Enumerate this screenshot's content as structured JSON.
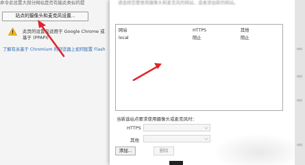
{
  "background_page": {
    "top_text": "命令此设置大部分网站是否有能此类似的提",
    "site_button_label": "站点的摄像头和麦克风设置...",
    "warning_text": "此页的设置仅适用于 Google Chrome 或基于 (PPAPI) 。",
    "link_text": "了解有关基于 Chromium 的浏览器上如何配置 Flash"
  },
  "dialog": {
    "top_text": "请选择您要使用摄像头和麦克风的网站，或者添加新的网站。",
    "list": {
      "headers": [
        "网站",
        "HTTPS",
        "其他"
      ],
      "rows": [
        {
          "site": "local",
          "https": "阻止",
          "other": "阻止"
        }
      ]
    },
    "mic_camera_label": "当新选站点要求使用摄像头或麦克风时：",
    "https_label": "HTTPS",
    "other_label": "其他",
    "https_value": "",
    "other_value": "",
    "add_button": "添加...",
    "delete_button": "删除"
  },
  "colors": {
    "arrow": "#e0242b",
    "link": "#2a6ab8",
    "warning": "#f2b61a"
  }
}
